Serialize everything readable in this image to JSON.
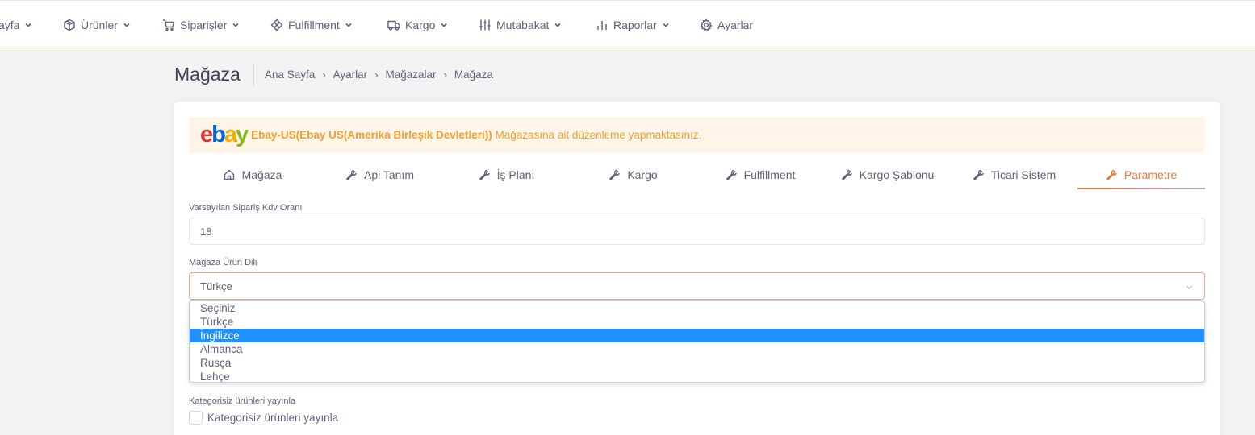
{
  "nav": {
    "items": [
      {
        "label": "ayfa",
        "icon": "none"
      },
      {
        "label": "Ürünler",
        "icon": "box-icon"
      },
      {
        "label": "Siparişler",
        "icon": "cart-icon"
      },
      {
        "label": "Fulfillment",
        "icon": "cube-icon"
      },
      {
        "label": "Kargo",
        "icon": "truck-icon"
      },
      {
        "label": "Mutabakat",
        "icon": "sliders-icon"
      },
      {
        "label": "Raporlar",
        "icon": "bar-chart-icon"
      },
      {
        "label": "Ayarlar",
        "icon": "gear-icon"
      }
    ]
  },
  "toolbar": {
    "title": "Mağaza",
    "breadcrumb": [
      "Ana Sayfa",
      "Ayarlar",
      "Mağazalar",
      "Mağaza"
    ]
  },
  "alert": {
    "logo_letters": [
      "e",
      "b",
      "a",
      "y"
    ],
    "store_name": "Ebay-US(Ebay US(Amerika Birleşik Devletleri))",
    "message": " Mağazasına ait düzenleme yapmaktasınız."
  },
  "tabs": [
    {
      "label": "Mağaza",
      "icon": "home-icon"
    },
    {
      "label": "Api Tanım",
      "icon": "wrench-icon"
    },
    {
      "label": "İş Planı",
      "icon": "wrench-icon"
    },
    {
      "label": "Kargo",
      "icon": "wrench-icon"
    },
    {
      "label": "Fulfillment",
      "icon": "wrench-icon"
    },
    {
      "label": "Kargo Şablonu",
      "icon": "wrench-icon"
    },
    {
      "label": "Ticari Sistem",
      "icon": "wrench-icon"
    },
    {
      "label": "Parametre",
      "icon": "wrench-icon"
    }
  ],
  "active_tab": "Parametre",
  "form": {
    "vat_label": "Varsayılan Sipariş Kdv Oranı",
    "vat_value": "18",
    "language_label": "Mağaza Ürün Dili",
    "language_value": "Türkçe",
    "language_options": [
      "Seçiniz",
      "Türkçe",
      "İngilizce",
      "Almanca",
      "Rusça",
      "Lehçe"
    ],
    "highlighted_option": "İngilizce",
    "publish_label": "Kategorisiz ürünleri yayınla",
    "publish_checkbox_label": "Kategorisiz ürünleri yayınla",
    "publish_checked": false
  },
  "colors": {
    "accent": "#f0783c",
    "alert_bg": "#fff4e8",
    "alert_text": "#f0a031",
    "option_highlight": "#1e90ff"
  }
}
